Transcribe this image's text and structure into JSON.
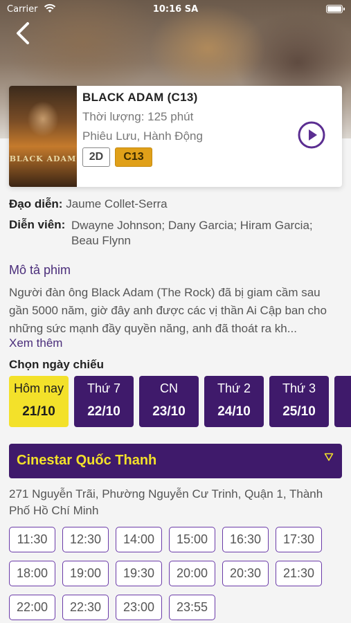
{
  "status": {
    "carrier": "Carrier",
    "time": "10:16 SA"
  },
  "movie": {
    "title": "BLACK ADAM (C13)",
    "duration": "Thời lượng: 125 phút",
    "genre": "Phiêu Lưu, Hành Động",
    "format": "2D",
    "rating": "C13",
    "poster_title": "BLACK ADAM"
  },
  "details": {
    "director_label": "Đạo diễn:",
    "director": "Jaume Collet-Serra",
    "cast_label": "Diễn viên:",
    "cast": "Dwayne Johnson; Dany Garcia; Hiram Garcia; Beau Flynn"
  },
  "description": {
    "title": "Mô tả phim",
    "text": "Người đàn ông Black Adam (The Rock) đã bị giam cầm sau gần 5000 năm, giờ đây anh được các vị thần Ai Cập ban cho những sức mạnh đầy quyền năng, anh đã thoát ra kh...",
    "see_more": "Xem thêm"
  },
  "dates": {
    "title": "Chọn ngày chiếu",
    "items": [
      {
        "day": "Hôm nay",
        "date": "21/10",
        "selected": true
      },
      {
        "day": "Thứ 7",
        "date": "22/10",
        "selected": false
      },
      {
        "day": "CN",
        "date": "23/10",
        "selected": false
      },
      {
        "day": "Thứ 2",
        "date": "24/10",
        "selected": false
      },
      {
        "day": "Thứ 3",
        "date": "25/10",
        "selected": false
      }
    ]
  },
  "cinema": {
    "name": "Cinestar Quốc Thanh",
    "address": "271 Nguyễn Trãi, Phường Nguyễn Cư Trinh, Quận 1, Thành Phố Hồ Chí Minh"
  },
  "showtimes": [
    "11:30",
    "12:30",
    "14:00",
    "15:00",
    "16:30",
    "17:30",
    "18:00",
    "19:00",
    "19:30",
    "20:00",
    "20:30",
    "21:30",
    "22:00",
    "22:30",
    "23:00",
    "23:55"
  ],
  "colors": {
    "primary": "#3f1a6b",
    "accent": "#f3e12a",
    "rating": "#e0a019"
  }
}
